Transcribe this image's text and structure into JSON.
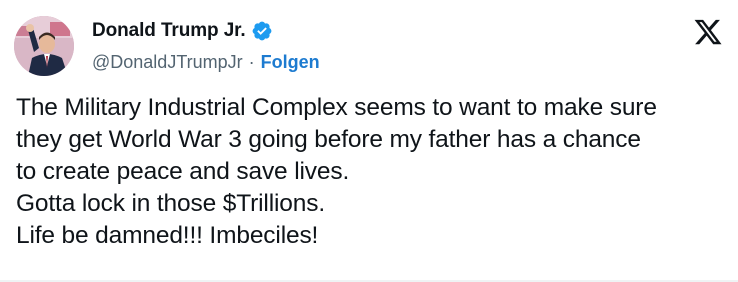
{
  "author": {
    "display_name": "Donald Trump Jr.",
    "handle": "@DonaldJTrumpJr",
    "separator": "·",
    "follow_label": "Folgen",
    "verified": true
  },
  "platform": {
    "logo_icon": "x-logo-icon"
  },
  "tweet": {
    "lines": [
      "The Military Industrial Complex seems to want to make sure",
      "they get World War 3 going before my father has a chance",
      "to create peace and save lives.",
      "Gotta lock in those $Trillions.",
      "Life be damned!!! Imbeciles!"
    ]
  },
  "colors": {
    "text": "#0f1419",
    "muted": "#536471",
    "link": "#1d7bd0",
    "verified_badge": "#1d9bf0"
  }
}
